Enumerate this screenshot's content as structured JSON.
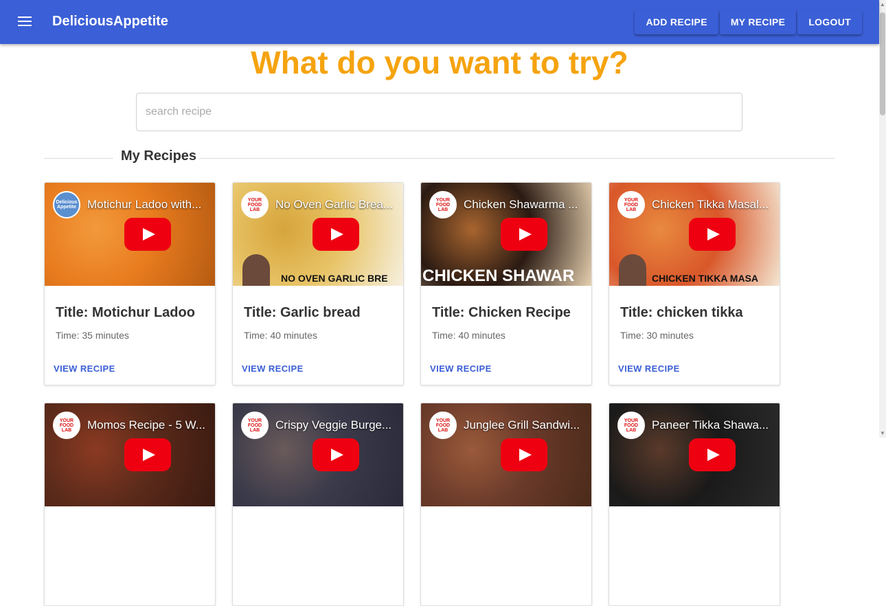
{
  "app": {
    "title": "DeliciousAppetite"
  },
  "nav": {
    "add_recipe": "ADD RECIPE",
    "my_recipe": "MY RECIPE",
    "logout": "LOGOUT"
  },
  "headline": "What do you want to try?",
  "search": {
    "placeholder": "search recipe",
    "value": ""
  },
  "section": {
    "title": "My Recipes"
  },
  "cards": [
    {
      "video_title": "Motichur Ladoo with...",
      "logo_text": "Delicious Appetite",
      "title": "Title: Motichur Ladoo",
      "time": "Time: 35 minutes",
      "button": "VIEW RECIPE",
      "banner": "",
      "colors": [
        "#e87b1e",
        "#f29a3c",
        "#b55b12"
      ]
    },
    {
      "video_title": "No Oven Garlic Brea...",
      "logo_text": "YOUR FOOD LAB",
      "title": "Title: Garlic bread",
      "time": "Time: 40 minutes",
      "button": "VIEW RECIPE",
      "banner": "NO OVEN GARLIC BRE",
      "colors": [
        "#e8c467",
        "#d7a43b",
        "#f6f0e0"
      ]
    },
    {
      "video_title": "Chicken Shawarma ...",
      "logo_text": "YOUR FOOD LAB",
      "title": "Title: Chicken Recipe",
      "time": "Time: 40 minutes",
      "button": "VIEW RECIPE",
      "banner": "CHICKEN SHAWAR",
      "colors": [
        "#2a1a12",
        "#a8652f",
        "#e6d0b0"
      ]
    },
    {
      "video_title": "Chicken Tikka Masal...",
      "logo_text": "YOUR FOOD LAB",
      "title": "Title: chicken tikka",
      "time": "Time: 30 minutes",
      "button": "VIEW RECIPE",
      "banner": "CHICKEN TIKKA MASA",
      "colors": [
        "#d9572a",
        "#e88a3f",
        "#f3e6d2"
      ]
    },
    {
      "video_title": "Momos Recipe - 5 W...",
      "logo_text": "YOUR FOOD LAB",
      "title": "",
      "time": "",
      "button": "",
      "banner": "",
      "colors": [
        "#5a2a1a",
        "#8b3a22",
        "#3a1a10"
      ]
    },
    {
      "video_title": "Crispy Veggie Burge...",
      "logo_text": "YOUR FOOD LAB",
      "title": "",
      "time": "",
      "button": "",
      "banner": "",
      "colors": [
        "#3a3a4a",
        "#6a5a5a",
        "#2a2a3a"
      ]
    },
    {
      "video_title": "Junglee Grill Sandwi...",
      "logo_text": "YOUR FOOD LAB",
      "title": "",
      "time": "",
      "button": "",
      "banner": "",
      "colors": [
        "#6a3a2a",
        "#9a5a3a",
        "#4a2a1a"
      ]
    },
    {
      "video_title": "Paneer Tikka Shawa...",
      "logo_text": "YOUR FOOD LAB",
      "title": "",
      "time": "",
      "button": "",
      "banner": "",
      "colors": [
        "#1a1a1a",
        "#5a3a2a",
        "#2a2a2a"
      ]
    }
  ]
}
